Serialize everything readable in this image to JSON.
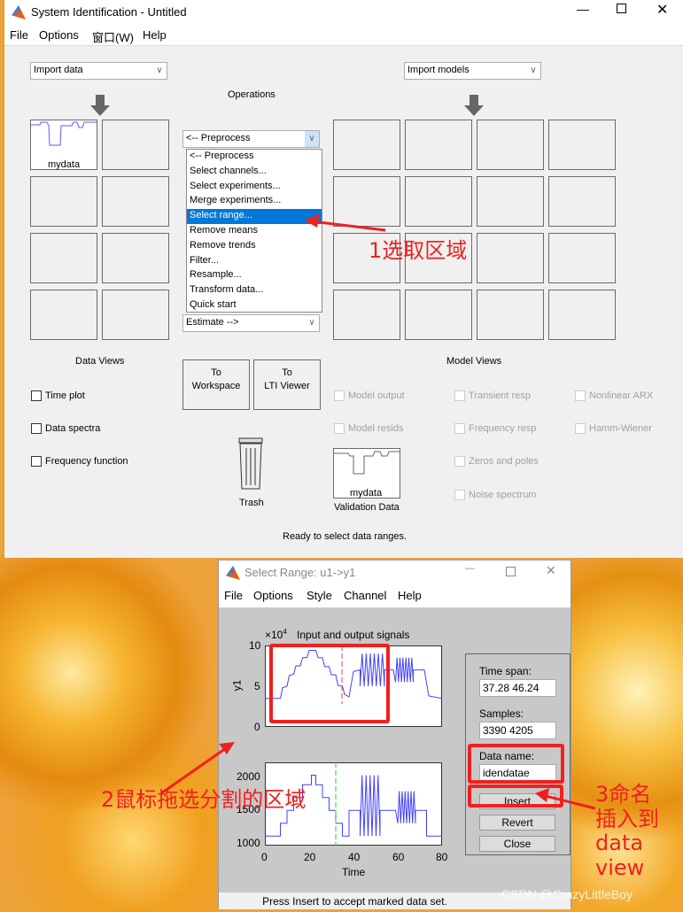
{
  "main": {
    "title": "System Identification - Untitled",
    "menu": [
      "File",
      "Options",
      "窗口(W)",
      "Help"
    ],
    "import_data": "Import data",
    "import_models": "Import models",
    "operations": "Operations",
    "preprocess": "<-- Preprocess",
    "preprocess_options": [
      "<-- Preprocess",
      "Select channels...",
      "Select experiments...",
      "Merge experiments...",
      "Select range...",
      "Remove means",
      "Remove trends",
      "Filter...",
      "Resample...",
      "Transform data...",
      "Quick start"
    ],
    "selected_option": "Select range...",
    "estimate": "Estimate -->",
    "data_tile": "mydata",
    "data_views": "Data Views",
    "model_views": "Model Views",
    "data_view_checks": [
      "Time plot",
      "Data spectra",
      "Frequency function"
    ],
    "model_view_checks": [
      "Model output",
      "Model resids",
      "Transient resp",
      "Frequency resp",
      "Zeros and poles",
      "Noise spectrum",
      "Nonlinear ARX",
      "Hamm-Wiener"
    ],
    "to_workspace": [
      "To",
      "Workspace"
    ],
    "to_lti": [
      "To",
      "LTI Viewer"
    ],
    "trash": "Trash",
    "validation_label": "Validation Data",
    "validation_tile": "mydata",
    "status": "Ready to select data ranges."
  },
  "dialog": {
    "title": "Select Range: u1->y1",
    "menu": [
      "File",
      "Options",
      "Style",
      "Channel",
      "Help"
    ],
    "plot_title": "Input and output signals",
    "exponent": "×10",
    "exponent_power": "4",
    "ylabel": "y1",
    "xlabel": "Time",
    "top_yticks": [
      "10",
      "5",
      "0"
    ],
    "bottom_yticks": [
      "2000",
      "1500",
      "1000"
    ],
    "xticks": [
      "0",
      "20",
      "40",
      "60",
      "80"
    ],
    "time_span_label": "Time span:",
    "time_span": "37.28 46.24",
    "samples_label": "Samples:",
    "samples": "3390 4205",
    "data_name_label": "Data name:",
    "data_name": "idendatae",
    "insert": "Insert",
    "revert": "Revert",
    "close": "Close",
    "status": "Press Insert to accept marked data set."
  },
  "annotations": {
    "step1": "1选取区域",
    "step2": "2鼠标拖选分割的区域",
    "step3": [
      "3命名",
      "插入到",
      "data",
      "view"
    ]
  },
  "watermark": "CSDN @CrazyLittleBoy",
  "colors": {
    "signal": "#4040ff",
    "annotation": "#f02020",
    "selection": "#0078d7"
  }
}
